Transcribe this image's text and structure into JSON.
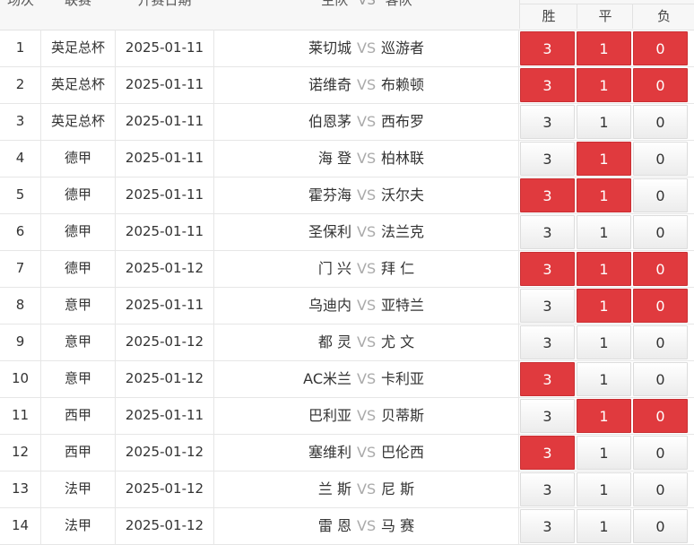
{
  "header": {
    "col_index": "场次",
    "col_league": "联赛",
    "col_date": "开赛日期",
    "col_match_home": "主队",
    "col_match_vs": "VS",
    "col_match_away": "客队",
    "col_win": "胜",
    "col_draw": "平",
    "col_lose": "负"
  },
  "colors": {
    "selected": "#e03a3e",
    "vs_gray": "#aaaaaa",
    "border": "#e6e6e6"
  },
  "vs_label": "VS",
  "rows": [
    {
      "idx": "1",
      "league": "英足总杯",
      "date": "2025-01-11",
      "home": "莱切城",
      "away": "巡游者",
      "win": "3",
      "draw": "1",
      "lose": "0",
      "sel": [
        true,
        true,
        true
      ]
    },
    {
      "idx": "2",
      "league": "英足总杯",
      "date": "2025-01-11",
      "home": "诺维奇",
      "away": "布赖顿",
      "win": "3",
      "draw": "1",
      "lose": "0",
      "sel": [
        true,
        true,
        true
      ]
    },
    {
      "idx": "3",
      "league": "英足总杯",
      "date": "2025-01-11",
      "home": "伯恩茅",
      "away": "西布罗",
      "win": "3",
      "draw": "1",
      "lose": "0",
      "sel": [
        false,
        false,
        false
      ]
    },
    {
      "idx": "4",
      "league": "德甲",
      "date": "2025-01-11",
      "home": "海 登",
      "away": "柏林联",
      "win": "3",
      "draw": "1",
      "lose": "0",
      "sel": [
        false,
        true,
        false
      ]
    },
    {
      "idx": "5",
      "league": "德甲",
      "date": "2025-01-11",
      "home": "霍芬海",
      "away": "沃尔夫",
      "win": "3",
      "draw": "1",
      "lose": "0",
      "sel": [
        true,
        true,
        false
      ]
    },
    {
      "idx": "6",
      "league": "德甲",
      "date": "2025-01-11",
      "home": "圣保利",
      "away": "法兰克",
      "win": "3",
      "draw": "1",
      "lose": "0",
      "sel": [
        false,
        false,
        false
      ]
    },
    {
      "idx": "7",
      "league": "德甲",
      "date": "2025-01-12",
      "home": "门 兴",
      "away": "拜 仁",
      "win": "3",
      "draw": "1",
      "lose": "0",
      "sel": [
        true,
        true,
        true
      ]
    },
    {
      "idx": "8",
      "league": "意甲",
      "date": "2025-01-11",
      "home": "乌迪内",
      "away": "亚特兰",
      "win": "3",
      "draw": "1",
      "lose": "0",
      "sel": [
        false,
        true,
        true
      ]
    },
    {
      "idx": "9",
      "league": "意甲",
      "date": "2025-01-12",
      "home": "都 灵",
      "away": "尤 文",
      "win": "3",
      "draw": "1",
      "lose": "0",
      "sel": [
        false,
        false,
        false
      ]
    },
    {
      "idx": "10",
      "league": "意甲",
      "date": "2025-01-12",
      "home": "AC米兰",
      "away": "卡利亚",
      "win": "3",
      "draw": "1",
      "lose": "0",
      "sel": [
        true,
        false,
        false
      ]
    },
    {
      "idx": "11",
      "league": "西甲",
      "date": "2025-01-11",
      "home": "巴利亚",
      "away": "贝蒂斯",
      "win": "3",
      "draw": "1",
      "lose": "0",
      "sel": [
        false,
        true,
        true
      ]
    },
    {
      "idx": "12",
      "league": "西甲",
      "date": "2025-01-12",
      "home": "塞维利",
      "away": "巴伦西",
      "win": "3",
      "draw": "1",
      "lose": "0",
      "sel": [
        true,
        false,
        false
      ]
    },
    {
      "idx": "13",
      "league": "法甲",
      "date": "2025-01-12",
      "home": "兰 斯",
      "away": "尼 斯",
      "win": "3",
      "draw": "1",
      "lose": "0",
      "sel": [
        false,
        false,
        false
      ]
    },
    {
      "idx": "14",
      "league": "法甲",
      "date": "2025-01-12",
      "home": "雷 恩",
      "away": "马 赛",
      "win": "3",
      "draw": "1",
      "lose": "0",
      "sel": [
        false,
        false,
        false
      ]
    }
  ]
}
